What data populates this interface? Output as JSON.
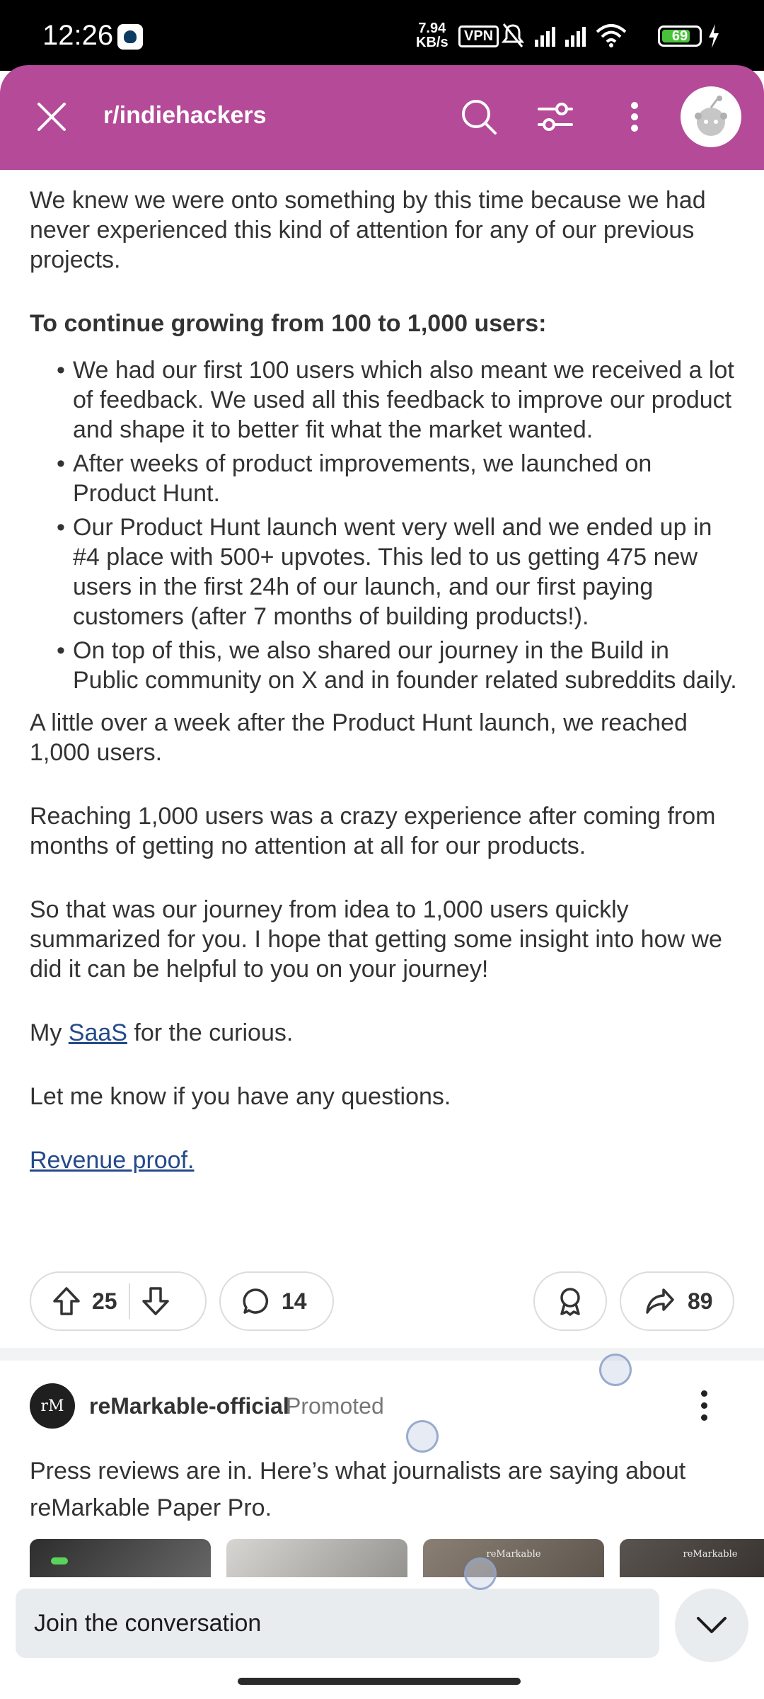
{
  "status_bar": {
    "time": "12:26",
    "speed_value": "7.94",
    "speed_unit": "KB/s",
    "vpn": "VPN",
    "battery": "69"
  },
  "header": {
    "subreddit": "r/indiehackers"
  },
  "post": {
    "paragraph_1": "We knew we were onto something by this time because we had never experienced this kind of attention for any of our previous projects.",
    "heading": "To continue growing from 100 to 1,000 users:",
    "bullets": [
      "We had our first 100 users which also meant we received a lot of feedback. We used all this feedback to improve our product and shape it to better fit what the market wanted.",
      "After weeks of product improvements, we launched on Product Hunt.",
      "Our Product Hunt launch went very well and we ended up in #4 place with 500+ upvotes. This led to us getting 475 new users in the first 24h of our launch, and our first paying customers (after 7 months of building products!).",
      "On top of this, we also shared our journey in the Build in Public community on X and in founder related subreddits daily."
    ],
    "paragraph_2": "A little over a week after the Product Hunt launch, we reached 1,000 users.",
    "paragraph_3": "Reaching 1,000 users was a crazy experience after coming from months of getting no attention at all for our products.",
    "paragraph_4": "So that was our journey from idea to 1,000 users quickly summarized for you. I hope that getting some insight into how we did it can be helpful to you on your journey!",
    "saas_prefix": "My ",
    "saas_link": "SaaS",
    "saas_suffix": " for the curious.",
    "paragraph_6": "Let me know if you have any questions.",
    "revenue_link": "Revenue proof."
  },
  "actions": {
    "upvotes": "25",
    "comments": "14",
    "shares": "89"
  },
  "promoted": {
    "avatar_text": "rM",
    "name": "reMarkable-official",
    "tag": "Promoted",
    "text": "Press reviews are in. Here’s what journalists are saying about reMarkable Paper Pro.",
    "thumb_label": "reMarkable"
  },
  "bottom": {
    "join_placeholder": "Join the conversation"
  }
}
